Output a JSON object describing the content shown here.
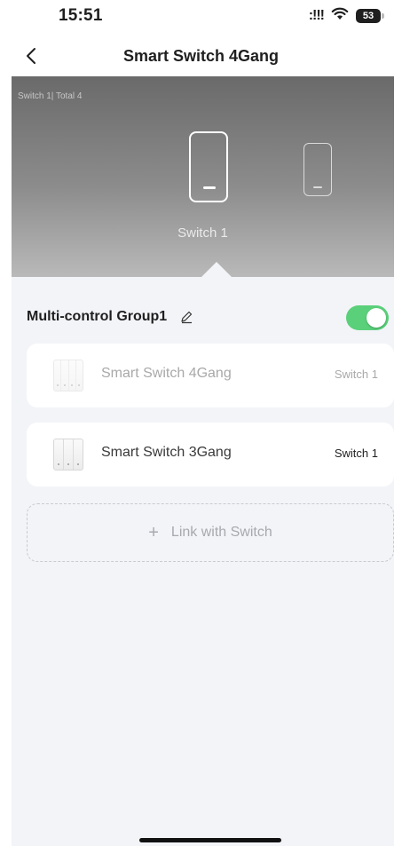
{
  "status_bar": {
    "time": "15:51",
    "signal": ":!!!",
    "battery": "53"
  },
  "nav": {
    "title": "Smart Switch 4Gang"
  },
  "hero": {
    "caption": "Switch 1| Total 4",
    "selected_label": "Switch 1"
  },
  "group": {
    "title": "Multi-control Group1",
    "enabled": true,
    "devices": [
      {
        "name": "Smart Switch 4Gang",
        "switch": "Switch 1",
        "dimmed": true,
        "gangs": 4
      },
      {
        "name": "Smart Switch 3Gang",
        "switch": "Switch 1",
        "dimmed": false,
        "gangs": 3
      }
    ]
  },
  "link_button": {
    "label": "Link with Switch"
  },
  "colors": {
    "toggle_on": "#5ad07a",
    "background": "#f3f4f8"
  }
}
